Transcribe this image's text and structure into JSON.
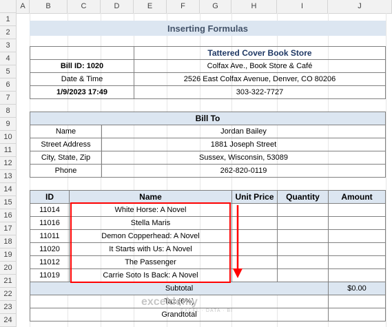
{
  "columns": [
    "A",
    "B",
    "C",
    "D",
    "E",
    "F",
    "G",
    "H",
    "I",
    "J"
  ],
  "rows": [
    "1",
    "2",
    "3",
    "4",
    "5",
    "6",
    "7",
    "8",
    "9",
    "10",
    "11",
    "12",
    "13",
    "14",
    "15",
    "16",
    "17",
    "18",
    "19",
    "20",
    "21",
    "22",
    "23",
    "24"
  ],
  "title": "Inserting Formulas",
  "store": {
    "name": "Tattered Cover Book Store",
    "bill_id": "Bill ID: 1020",
    "address_line1": "Colfax Ave., Book Store & Café",
    "date_label": "Date & Time",
    "address_line2": "2526 East Colfax Avenue, Denver, CO 80206",
    "date_value": "1/9/2023 17:49",
    "phone": "303-322-7727"
  },
  "bill_to": {
    "heading": "Bill To",
    "fields": [
      {
        "label": "Name",
        "value": "Jordan Bailey"
      },
      {
        "label": "Street Address",
        "value": "1881 Joseph Street"
      },
      {
        "label": "City, State, Zip",
        "value": "Sussex, Wisconsin, 53089"
      },
      {
        "label": "Phone",
        "value": "262-820-0119"
      }
    ]
  },
  "items_table": {
    "headers": {
      "id": "ID",
      "name": "Name",
      "unit_price": "Unit Price",
      "quantity": "Quantity",
      "amount": "Amount"
    },
    "rows": [
      {
        "id": "11014",
        "name": "White Horse: A Novel"
      },
      {
        "id": "11016",
        "name": "Stella Maris"
      },
      {
        "id": "11011",
        "name": "Demon Copperhead: A Novel"
      },
      {
        "id": "11020",
        "name": "It Starts with Us: A Novel"
      },
      {
        "id": "11012",
        "name": "The Passenger"
      },
      {
        "id": "11019",
        "name": "Carrie Soto Is Back: A Novel"
      }
    ],
    "subtotal_label": "Subtotal",
    "subtotal_value": "$0.00",
    "tax_label": "Tax (6%)",
    "grandtotal_label": "Grandtotal"
  },
  "watermark": {
    "brand": "exceldemy",
    "tagline": "EXCEL · DATA · BI"
  },
  "colors": {
    "accent_blue": "#dce6f1",
    "highlight_red": "#ff0000",
    "title_text": "#44546a"
  }
}
